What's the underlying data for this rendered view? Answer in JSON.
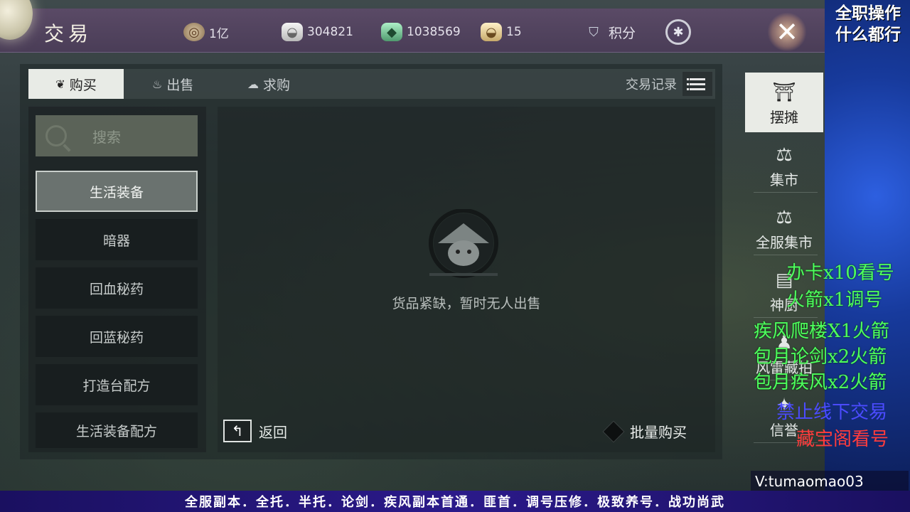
{
  "header": {
    "title": "交易",
    "resources": [
      {
        "icon": "coin-icon",
        "value": "1亿"
      },
      {
        "icon": "silver-ingot-icon",
        "value": "304821"
      },
      {
        "icon": "jade-icon",
        "value": "1038569"
      },
      {
        "icon": "gold-ingot-icon",
        "value": "15"
      }
    ],
    "score_label": "积分"
  },
  "tabs": [
    {
      "label": "购买",
      "icon": "buy-icon"
    },
    {
      "label": "出售",
      "icon": "sell-icon"
    },
    {
      "label": "求购",
      "icon": "request-icon"
    }
  ],
  "records_label": "交易记录",
  "search_placeholder": "搜索",
  "categories": [
    "生活装备",
    "暗器",
    "回血秘药",
    "回蓝秘药",
    "打造台配方",
    "生活装备配方"
  ],
  "empty_message": "货品紧缺，暂时无人出售",
  "back_label": "返回",
  "bulk_buy_label": "批量购买",
  "side_nav": [
    "摆摊",
    "集市",
    "全服集市",
    "神厨",
    "风雷藏拍",
    "信誉"
  ],
  "overlay": {
    "title_line1": "全职操作",
    "title_line2": "什么都行",
    "ads": [
      "办卡x10看号",
      "火箭x1调号",
      "疾风爬楼X1火箭",
      "包月论剑x2火箭",
      "包月疾风x2火箭",
      "禁止线下交易",
      "藏宝阁看号"
    ],
    "handle": "V:tumaomao03",
    "banner": "全服副本．全托．半托．论剑．疾风副本首通．匪首．调号压修．极致养号．战功尚武"
  },
  "colors": {
    "topbar": "#4a3d57",
    "ad_green": "#4eff5e",
    "ad_blue": "#4b4bff",
    "ad_red": "#ff3c3c",
    "banner": "#2b1a8a"
  }
}
